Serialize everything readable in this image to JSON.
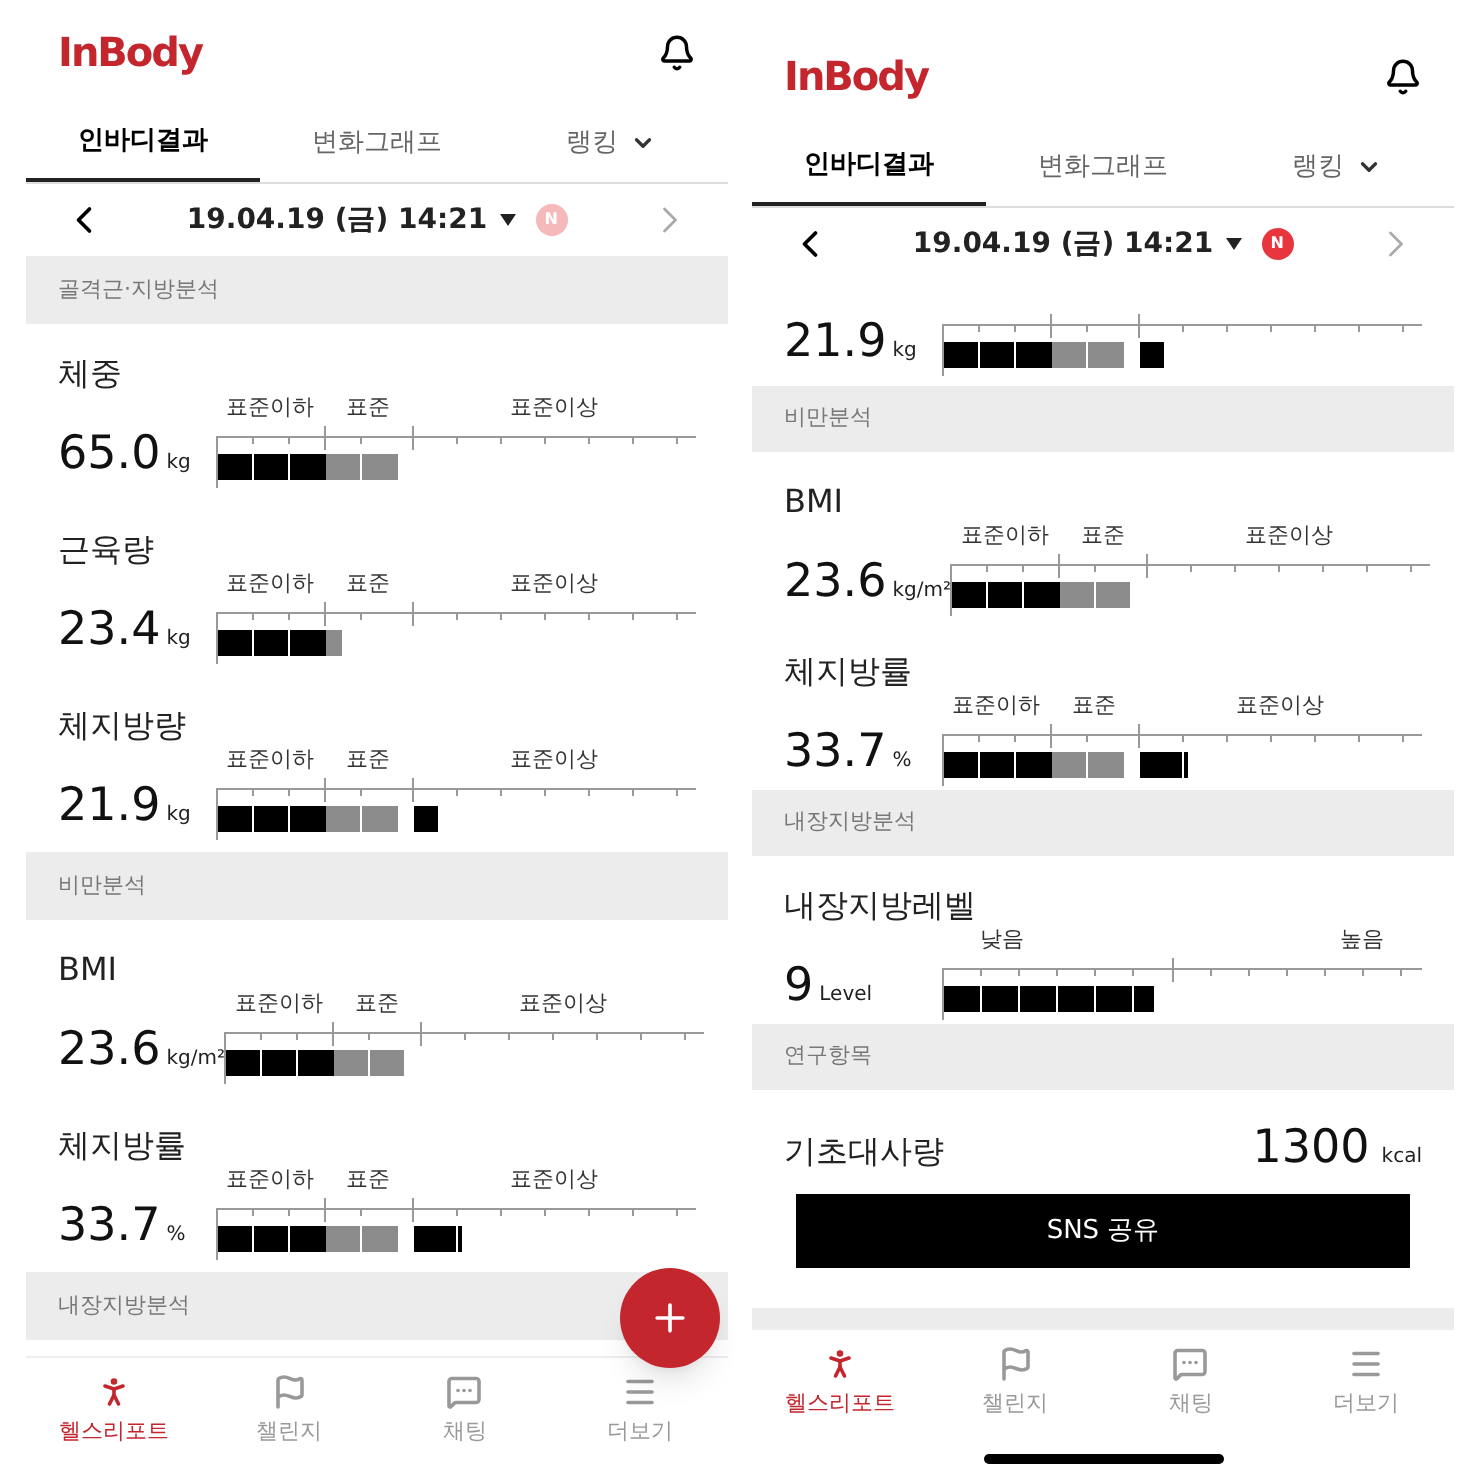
{
  "screens": [
    {
      "logo": "InBody",
      "top_gap": false,
      "tabs": [
        {
          "label": "인바디결과",
          "selected": true,
          "dropdown": false
        },
        {
          "label": "변화그래프",
          "selected": false,
          "dropdown": false
        },
        {
          "label": "랭킹",
          "selected": false,
          "dropdown": true
        }
      ],
      "date_nav": {
        "date": "19.04.19 (금) 14:21",
        "badge": "N",
        "badge_faded": true,
        "next_disabled": true
      },
      "items": [
        {
          "kind": "section",
          "title": "골격근·지방분석"
        },
        {
          "kind": "metric",
          "title": "체중",
          "value": "65.0",
          "unit": "kg",
          "labels": [
            "표준이하",
            "표준",
            "표준이상"
          ],
          "level": 0.38
        },
        {
          "kind": "metric",
          "title": "근육량",
          "value": "23.4",
          "unit": "kg",
          "labels": [
            "표준이하",
            "표준",
            "표준이상"
          ],
          "level": 0.26
        },
        {
          "kind": "metric",
          "title": "체지방량",
          "value": "21.9",
          "unit": "kg",
          "labels": [
            "표준이하",
            "표준",
            "표준이상"
          ],
          "level": 0.46
        },
        {
          "kind": "section",
          "title": "비만분석"
        },
        {
          "kind": "metric",
          "title": "BMI",
          "value": "23.6",
          "unit": "kg/m²",
          "labels": [
            "표준이하",
            "표준",
            "표준이상"
          ],
          "level": 0.37
        },
        {
          "kind": "metric",
          "title": "체지방률",
          "value": "33.7",
          "unit": "%",
          "labels": [
            "표준이하",
            "표준",
            "표준이상"
          ],
          "level": 0.51
        },
        {
          "kind": "section",
          "title": "내장지방분석"
        }
      ],
      "fab": true,
      "nav": [
        {
          "label": "헬스리포트",
          "selected": true,
          "kind": "person"
        },
        {
          "label": "챌린지",
          "selected": false,
          "kind": "flag"
        },
        {
          "label": "채팅",
          "selected": false,
          "kind": "chat"
        },
        {
          "label": "더보기",
          "selected": false,
          "kind": "menu"
        }
      ]
    },
    {
      "logo": "InBody",
      "top_gap": true,
      "tabs": [
        {
          "label": "인바디결과",
          "selected": true,
          "dropdown": false
        },
        {
          "label": "변화그래프",
          "selected": false,
          "dropdown": false
        },
        {
          "label": "랭킹",
          "selected": false,
          "dropdown": true
        }
      ],
      "date_nav": {
        "date": "19.04.19 (금) 14:21",
        "badge": "N",
        "badge_faded": false,
        "next_disabled": true
      },
      "items": [
        {
          "kind": "metric",
          "value": "21.9",
          "unit": "kg",
          "level": 0.46
        },
        {
          "kind": "section",
          "title": "비만분석"
        },
        {
          "kind": "metric",
          "title": "BMI",
          "value": "23.6",
          "unit": "kg/m²",
          "labels": [
            "표준이하",
            "표준",
            "표준이상"
          ],
          "level": 0.37
        },
        {
          "kind": "metric",
          "title": "체지방률",
          "value": "33.7",
          "unit": "%",
          "labels": [
            "표준이하",
            "표준",
            "표준이상"
          ],
          "level": 0.51
        },
        {
          "kind": "section",
          "title": "내장지방분석"
        },
        {
          "kind": "level_metric",
          "title": "내장지방레벨",
          "value": "9",
          "unit": "Level",
          "labels": [
            "낮음",
            "높음"
          ],
          "level": 0.44
        },
        {
          "kind": "section",
          "title": "연구항목"
        },
        {
          "kind": "value",
          "title": "기초대사량",
          "value": "1300",
          "unit": "kcal"
        },
        {
          "kind": "button",
          "label": "SNS 공유"
        },
        {
          "kind": "band"
        }
      ],
      "home_indicator": true,
      "nav": [
        {
          "label": "헬스리포트",
          "selected": true,
          "kind": "person"
        },
        {
          "label": "챌린지",
          "selected": false,
          "kind": "flag"
        },
        {
          "label": "채팅",
          "selected": false,
          "kind": "chat"
        },
        {
          "label": "더보기",
          "selected": false,
          "kind": "menu"
        }
      ]
    }
  ]
}
